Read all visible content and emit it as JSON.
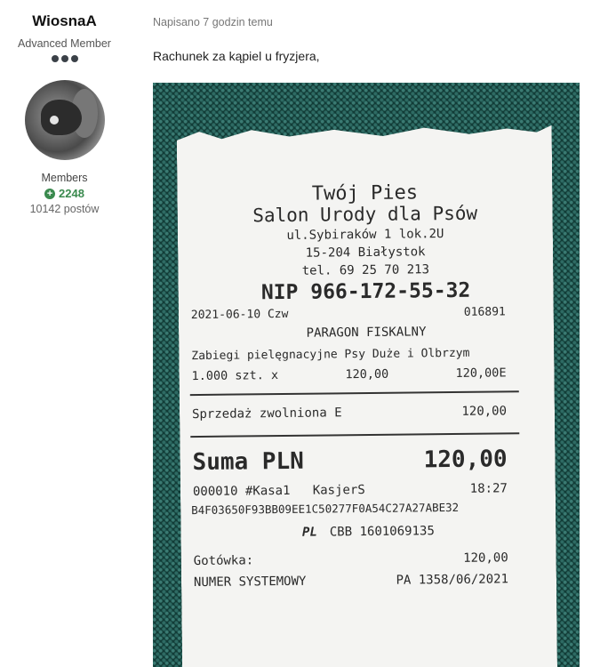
{
  "author": {
    "name": "WiosnaA",
    "rank": "Advanced Member",
    "group": "Members",
    "reputation": "2248",
    "posts": "10142 postów"
  },
  "post": {
    "meta": "Napisano 7 godzin temu",
    "text": "Rachunek za kąpiel u fryzjera,"
  },
  "receipt": {
    "store_name": "Twój Pies",
    "store_subtitle": "Salon Urody dla Psów",
    "address_street": "ul.Sybiraków 1 lok.2U",
    "address_city": "15-204 Białystok",
    "phone": "tel. 69 25 70 213",
    "nip": "NIP 966-172-55-32",
    "date": "2021-06-10 Czw",
    "doc_number": "016891",
    "doc_type": "PARAGON FISKALNY",
    "item_name": "Zabiegi pielęgnacyjne Psy Duże i Olbrzym",
    "item_qty": "1.000 szt. x",
    "item_price": "120,00",
    "item_total": "120,00E",
    "exempt_label": "Sprzedaż zwolniona E",
    "exempt_value": "120,00",
    "sum_label": "Suma PLN",
    "sum_value": "120,00",
    "register": "000010 #Kasa1   KasjerS",
    "time": "18:27",
    "hash": "B4F03650F93BB09EE1C50277F0A54C27A27ABE32",
    "logo": "PL",
    "device": "CBB 1601069135",
    "payment_label": "Gotówka:",
    "payment_value": "120,00",
    "system_label": "NUMER SYSTEMOWY",
    "system_value": "PA 1358/06/2021"
  }
}
